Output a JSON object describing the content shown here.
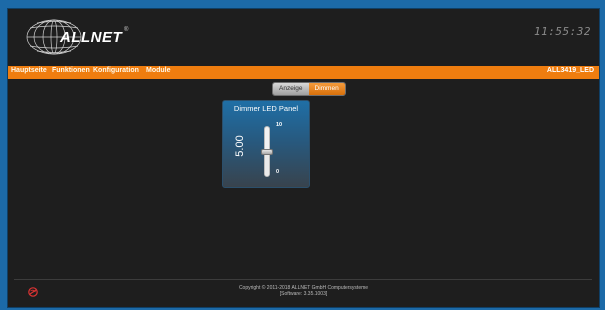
{
  "header": {
    "brand": "ALLNET",
    "clock": "11:55:32"
  },
  "nav": {
    "items": [
      "Hauptseite",
      "Funktionen",
      "Konfiguration",
      "Module"
    ],
    "device": "ALL3419_LED"
  },
  "tabs": [
    {
      "label": "Anzeige",
      "active": false
    },
    {
      "label": "Dimmen",
      "active": true
    }
  ],
  "panel": {
    "title": "Dimmer LED Panel",
    "value": "5.00",
    "slider": {
      "min": "0",
      "max": "10",
      "level": 0.5
    }
  },
  "footer": {
    "copyright": "Copyright © 2011-2018 ALLNET GmbH Computersysteme",
    "software": "[Software: 3.35.1003]"
  },
  "colors": {
    "accent": "#ef7d0f",
    "background": "#1e1e1e",
    "outer": "#1c6aa8"
  }
}
